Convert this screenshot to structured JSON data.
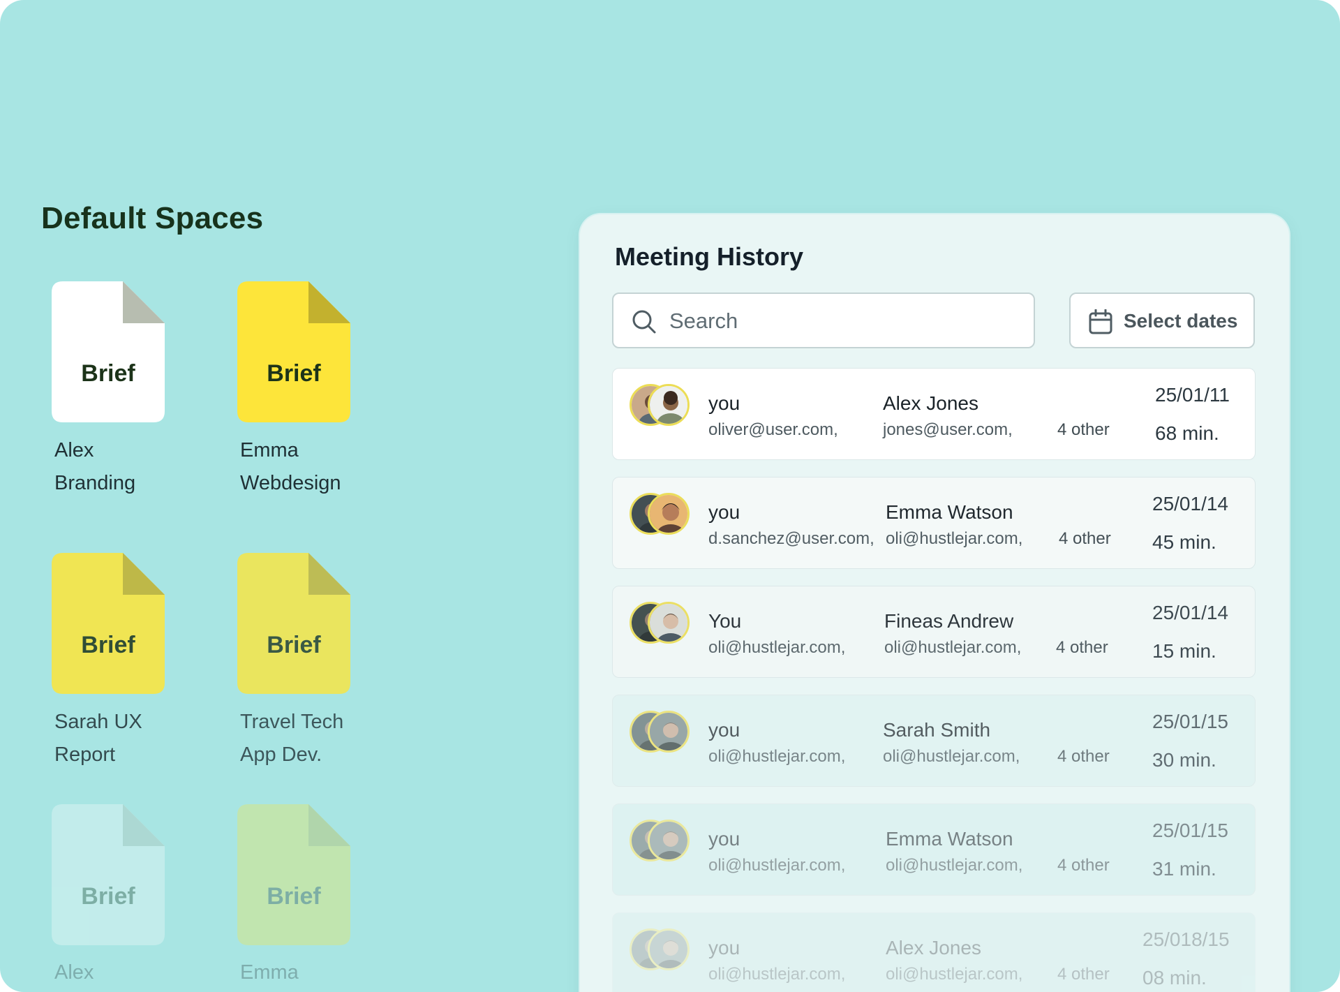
{
  "default_spaces": {
    "title": "Default Spaces",
    "items": [
      {
        "doc_label": "Brief",
        "name_line1": "Alex",
        "name_line2": "Branding",
        "color": "#ffffff",
        "fold": "#b7bdb0"
      },
      {
        "doc_label": "Brief",
        "name_line1": "Emma",
        "name_line2": "Webdesign",
        "color": "#fde53a",
        "fold": "#c3b12e"
      },
      {
        "doc_label": "Brief",
        "name_line1": "Sarah UX",
        "name_line2": "Report",
        "color": "#fde53a",
        "fold": "#c3b12e"
      },
      {
        "doc_label": "Brief",
        "name_line1": "Travel Tech",
        "name_line2": "App Dev.",
        "color": "#fde53a",
        "fold": "#c3b12e"
      },
      {
        "doc_label": "Brief",
        "name_line1": "Alex",
        "name_line2": "",
        "color": "#ffffff",
        "fold": "#b7bdb0"
      },
      {
        "doc_label": "Brief",
        "name_line1": "Emma",
        "name_line2": "",
        "color": "#fde53a",
        "fold": "#c3b12e"
      }
    ]
  },
  "meeting_history": {
    "title": "Meeting History",
    "search": {
      "placeholder": "Search",
      "value": ""
    },
    "select_dates_label": "Select dates",
    "meetings": [
      {
        "you_label": "you",
        "you_email": "oliver@user.com,",
        "other_name": "Alex Jones",
        "other_email": "jones@user.com,",
        "others": "4 other",
        "date": "25/01/11",
        "duration": "68 min."
      },
      {
        "you_label": "you",
        "you_email": "d.sanchez@user.com,",
        "other_name": "Emma Watson",
        "other_email": "oli@hustlejar.com,",
        "others": "4 other",
        "date": "25/01/14",
        "duration": "45 min."
      },
      {
        "you_label": "You",
        "you_email": "oli@hustlejar.com,",
        "other_name": "Fineas Andrew",
        "other_email": "oli@hustlejar.com,",
        "others": "4 other",
        "date": "25/01/14",
        "duration": "15 min."
      },
      {
        "you_label": "you",
        "you_email": "oli@hustlejar.com,",
        "other_name": "Sarah Smith",
        "other_email": "oli@hustlejar.com,",
        "others": "4 other",
        "date": "25/01/15",
        "duration": "30 min."
      },
      {
        "you_label": "you",
        "you_email": "oli@hustlejar.com,",
        "other_name": "Emma Watson",
        "other_email": "oli@hustlejar.com,",
        "others": "4 other",
        "date": "25/01/15",
        "duration": "31 min."
      },
      {
        "you_label": "you",
        "you_email": "oli@hustlejar.com,",
        "other_name": "Alex Jones",
        "other_email": "oli@hustlejar.com,",
        "others": "4 other",
        "date": "25/018/15",
        "duration": "08 min."
      }
    ]
  },
  "colors": {
    "background": "#a8e5e3",
    "panel": "#e9f6f5",
    "brief_yellow": "#fde53a",
    "avatar_ring": "#ecdd55"
  },
  "icons": {
    "search": "search-icon",
    "calendar": "calendar-icon"
  }
}
